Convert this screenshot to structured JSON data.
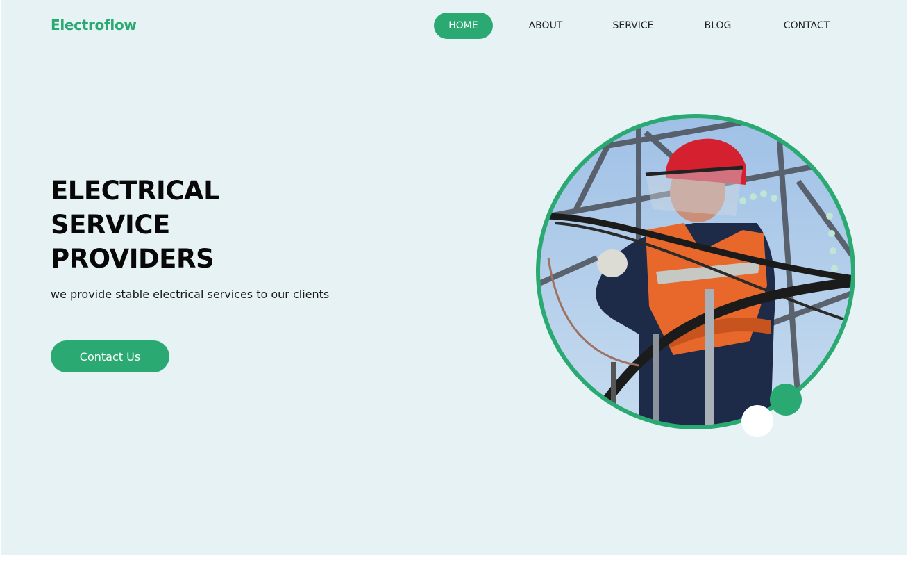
{
  "brand": {
    "name": "Electroflow",
    "accent_color": "#2aaa72",
    "background_color": "#e7f2f5"
  },
  "nav": {
    "items": [
      {
        "label": "HOME",
        "active": true
      },
      {
        "label": "ABOUT",
        "active": false
      },
      {
        "label": "SERVICE",
        "active": false
      },
      {
        "label": "BLOG",
        "active": false
      },
      {
        "label": "CONTACT",
        "active": false
      }
    ]
  },
  "hero": {
    "headline_lines": [
      "ELECTRICAL",
      "SERVICE",
      "PROVIDERS"
    ],
    "subtitle": "we provide stable electrical services to our clients",
    "cta_label": "Contact Us",
    "image": {
      "subject": "electrician-at-work-photo",
      "shape": "circle"
    }
  }
}
